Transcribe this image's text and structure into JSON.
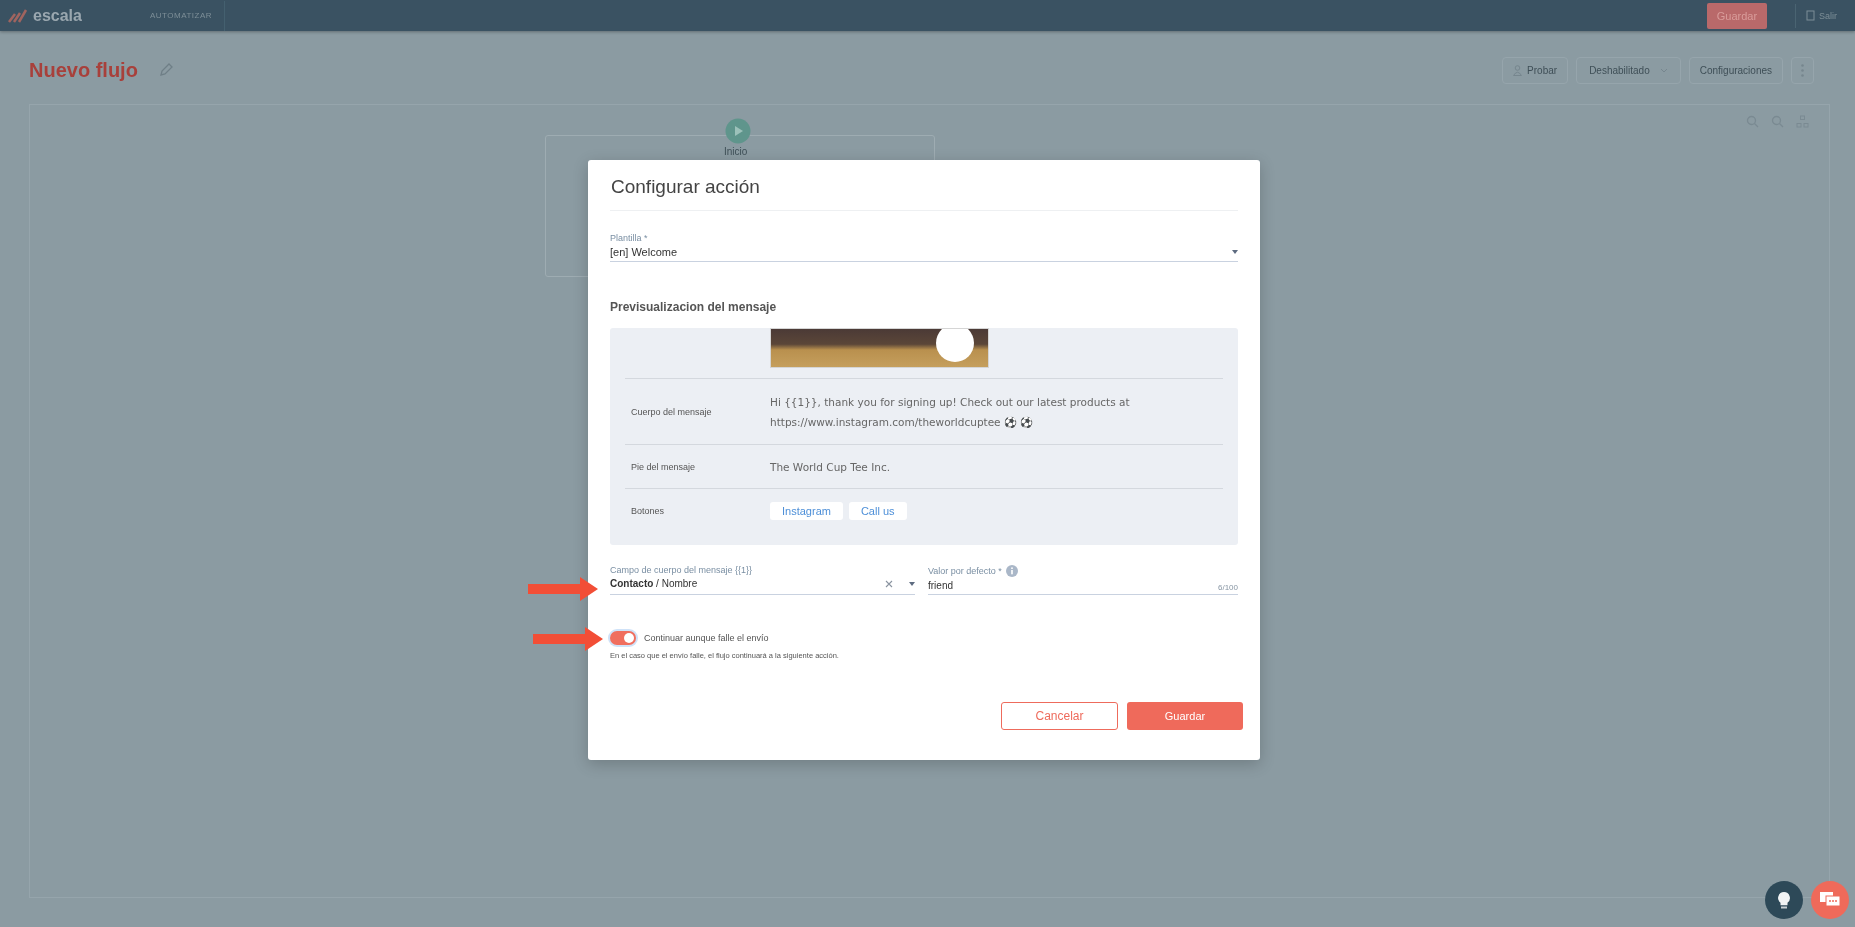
{
  "top_bar": {
    "logo": "escala",
    "nav_item": "AUTOMATIZAR",
    "save_button": "Guardar",
    "exit_button": "Salir"
  },
  "header": {
    "title": "Nuevo flujo",
    "test_button": "Probar",
    "status_select": "Deshabilitado",
    "settings_button": "Configuraciones"
  },
  "canvas": {
    "start_node": "Inicio"
  },
  "dialog": {
    "title": "Configurar acción",
    "template": {
      "label": "Plantilla *",
      "value": "[en] Welcome"
    },
    "preview_heading": "Previsualizacion del mensaje",
    "preview_rows": [
      {
        "kind": "text",
        "label": "Cuerpo del mensaje",
        "lines": [
          "Hi {{1}}, thank you for signing up! Check out our latest products at",
          "https://www.instagram.com/theworldcuptee ⚽ ⚽"
        ]
      },
      {
        "kind": "text",
        "label": "Pie del mensaje",
        "lines": [
          "The World Cup Tee Inc."
        ]
      },
      {
        "kind": "buttons",
        "label": "Botones",
        "buttons": [
          "Instagram",
          "Call us"
        ]
      }
    ],
    "body_field": {
      "label": "Campo de cuerpo del mensaje {{1}}",
      "value": "**Contacto** / Nombre"
    },
    "default_field": {
      "label": "Valor por defecto *",
      "value": "friend",
      "counter": "6/100"
    },
    "continue_toggle": {
      "label": "Continuar aunque falle el envío",
      "on": true,
      "hint": "En el caso que el envío falle, el flujo continuará a la siguiente acción."
    },
    "cancel_button": "Cancelar",
    "save_button": "Guardar"
  }
}
